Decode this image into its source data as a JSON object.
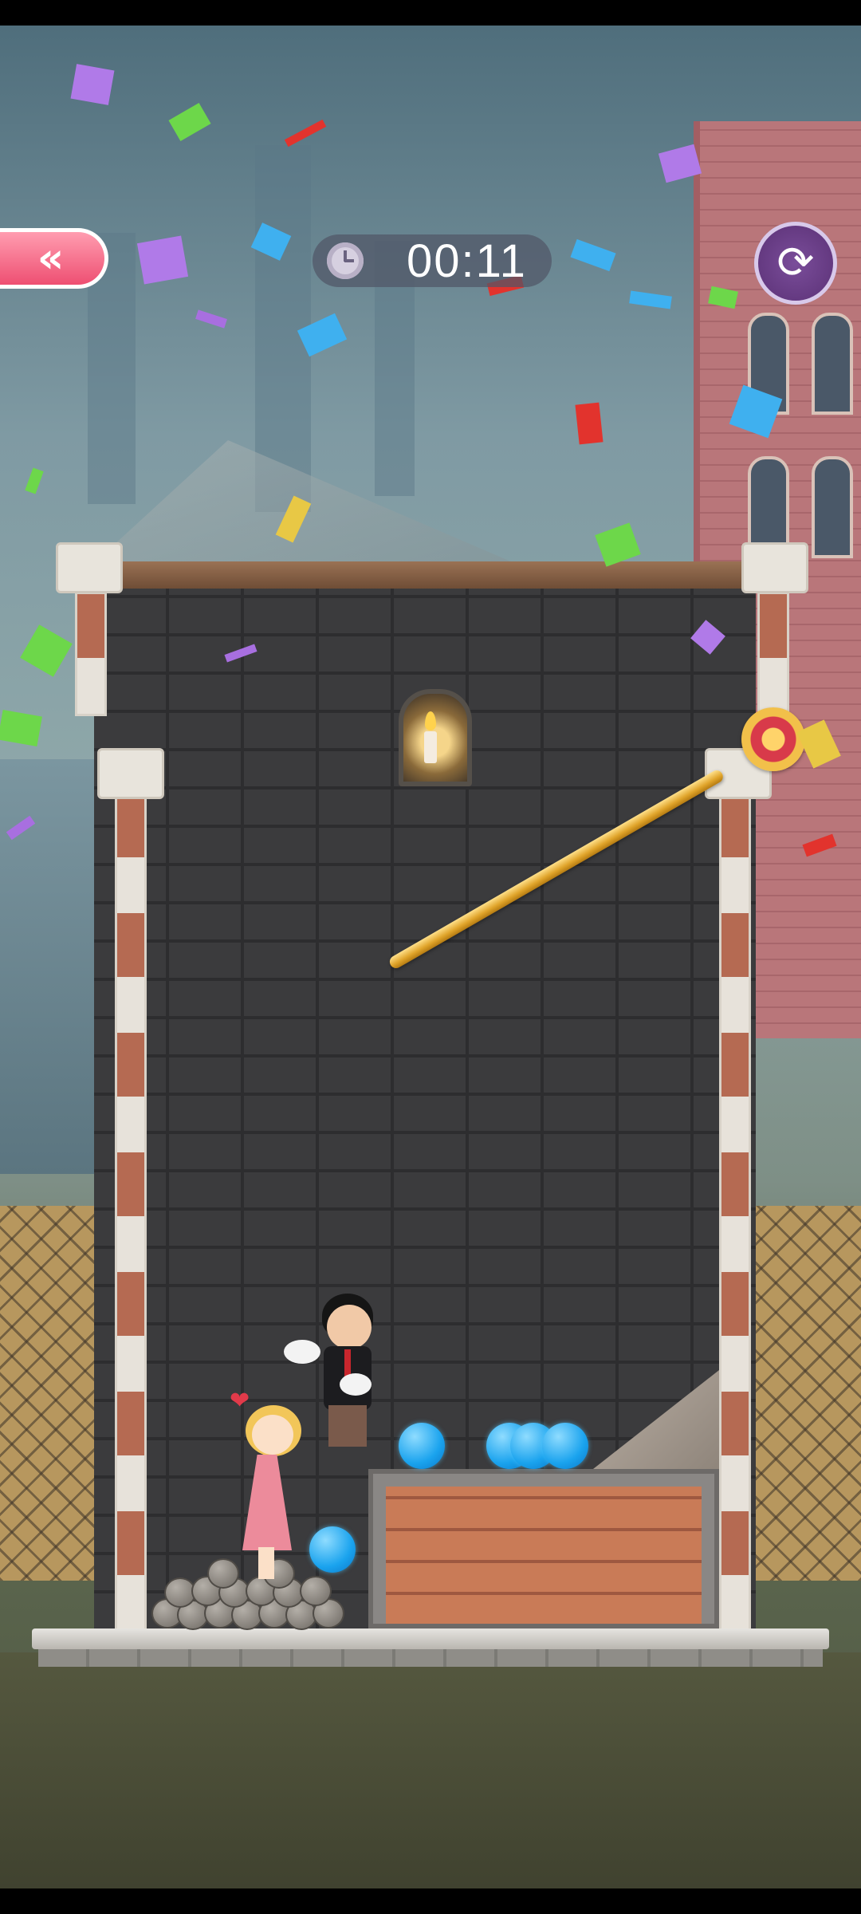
{
  "hud": {
    "back_icon_glyph": "«",
    "timer_text": "00:11",
    "restart_icon_glyph": "⟳"
  },
  "icons": {
    "back": "double-chevron-left-icon",
    "timer": "alarm-clock-icon",
    "restart": "restart-arrows-icon"
  },
  "colors": {
    "back_button": "#ee4f72",
    "restart_button": "#6a3d88",
    "pin": "#e0a42a",
    "water": "#1aa3ee"
  },
  "scene": {
    "heart_glyph": "❤"
  }
}
